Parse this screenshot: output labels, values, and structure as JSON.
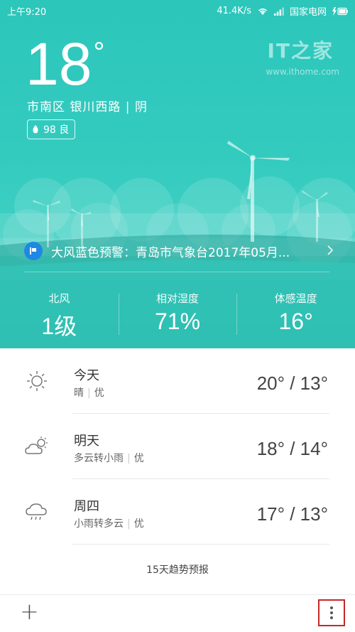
{
  "status_bar": {
    "time": "上午9:20",
    "speed": "41.4K/s",
    "carrier": "国家电网",
    "icons": [
      "wifi-icon",
      "signal-icon",
      "battery-charging-icon"
    ]
  },
  "current": {
    "temperature": "18",
    "degree_symbol": "°",
    "location": "市南区  银川西路 | 阴",
    "aqi_value": "98 良",
    "aqi_icon": "leaf-icon"
  },
  "watermark": {
    "logo": "IT之家",
    "url": "www.ithome.com"
  },
  "alert": {
    "icon": "weather-warning-icon",
    "text": "大风蓝色预警：青岛市气象台2017年05月..."
  },
  "stats": [
    {
      "label": "北风",
      "value": "1级"
    },
    {
      "label": "相对湿度",
      "value": "71%"
    },
    {
      "label": "体感温度",
      "value": "16°"
    }
  ],
  "forecast": [
    {
      "day": "今天",
      "condition": "晴",
      "quality": "优",
      "temps": "20° / 13°",
      "icon": "sunny-icon"
    },
    {
      "day": "明天",
      "condition": "多云转小雨",
      "quality": "优",
      "temps": "18° / 14°",
      "icon": "partly-cloudy-icon"
    },
    {
      "day": "周四",
      "condition": "小雨转多云",
      "quality": "优",
      "temps": "17° / 13°",
      "icon": "light-rain-icon"
    }
  ],
  "trend_label": "15天趋势预报",
  "bottom_bar": {
    "add_label": "+",
    "menu_icon": "more-vertical-icon"
  },
  "colors": {
    "hero": "#34cbbf",
    "alert_icon_bg": "#1e88e5",
    "menu_highlight": "#c62828"
  }
}
